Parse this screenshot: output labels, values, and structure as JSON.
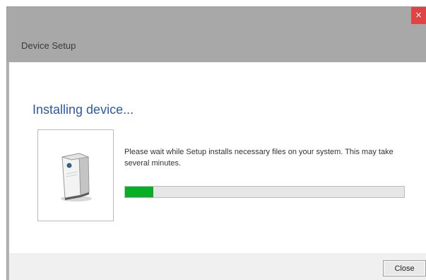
{
  "window": {
    "title": "Device Setup",
    "close_glyph": "×"
  },
  "main": {
    "heading": "Installing device...",
    "message": "Please wait while Setup installs necessary files on your system. This may take several minutes.",
    "device_icon": "device-tower-icon",
    "progress_percent": 10
  },
  "footer": {
    "close_label": "Close"
  },
  "colors": {
    "titlebar": "#a8a8a8",
    "close_button": "#e04343",
    "heading": "#2a59a8",
    "progress_fill": "#06b025"
  }
}
